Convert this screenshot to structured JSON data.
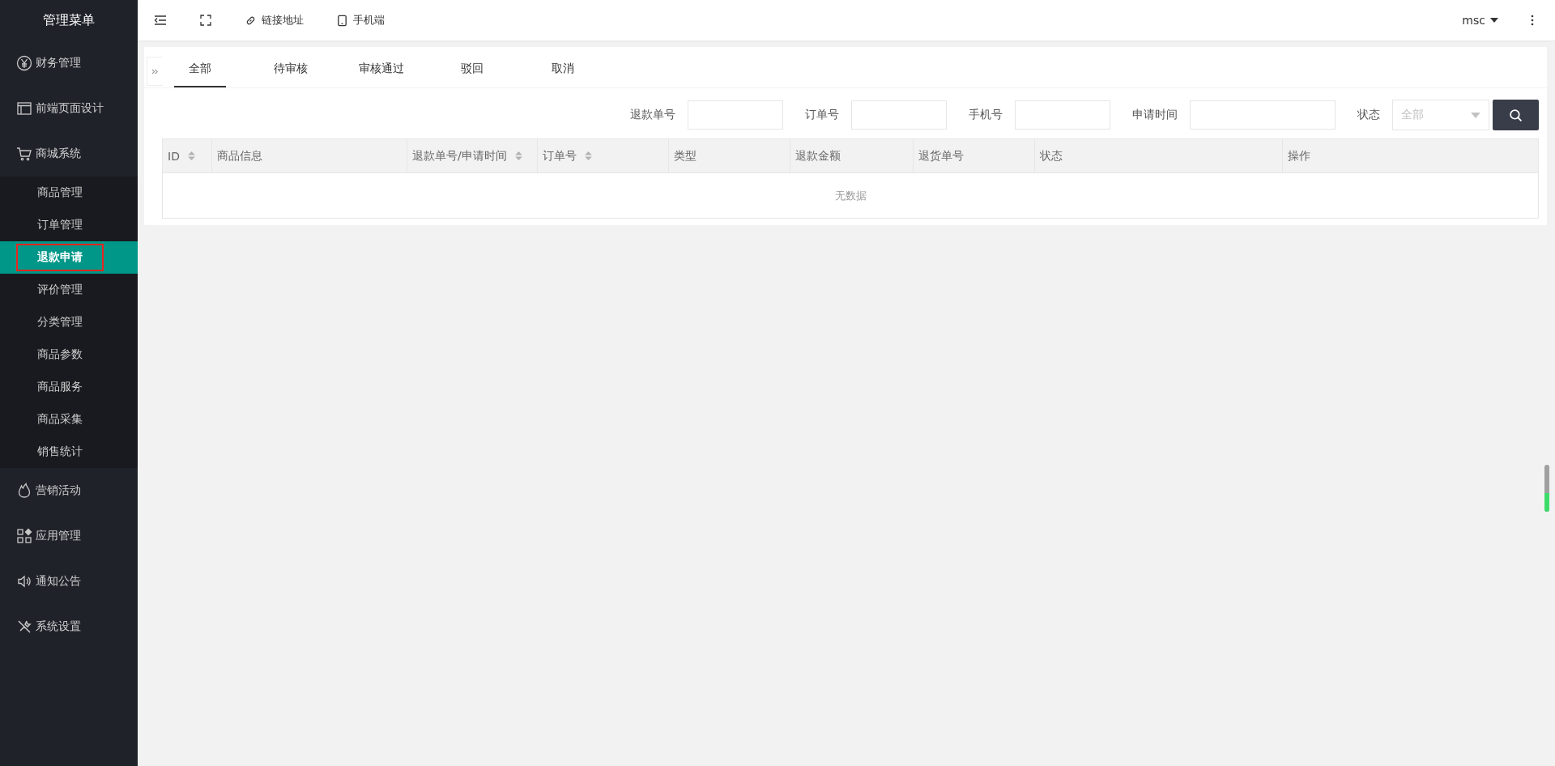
{
  "sidebar": {
    "title": "管理菜单",
    "items": [
      {
        "label": "财务管理",
        "selected": false
      },
      {
        "label": "前端页面设计",
        "selected": false
      },
      {
        "label": "商城系统",
        "selected": false,
        "children": [
          {
            "label": "商品管理",
            "selected": false,
            "highlighted": false
          },
          {
            "label": "订单管理",
            "selected": false,
            "highlighted": false
          },
          {
            "label": "退款申请",
            "selected": true,
            "highlighted": true
          },
          {
            "label": "评价管理",
            "selected": false,
            "highlighted": false
          },
          {
            "label": "分类管理",
            "selected": false,
            "highlighted": false
          },
          {
            "label": "商品参数",
            "selected": false,
            "highlighted": false
          },
          {
            "label": "商品服务",
            "selected": false,
            "highlighted": false
          },
          {
            "label": "商品采集",
            "selected": false,
            "highlighted": false
          },
          {
            "label": "销售统计",
            "selected": false,
            "highlighted": false
          }
        ]
      },
      {
        "label": "营销活动",
        "selected": false
      },
      {
        "label": "应用管理",
        "selected": false
      },
      {
        "label": "通知公告",
        "selected": false
      },
      {
        "label": "系统设置",
        "selected": false
      }
    ]
  },
  "toolbar": {
    "links": [
      "链接地址",
      "手机端"
    ],
    "user": "msc"
  },
  "tabs": [
    {
      "label": "全部",
      "selected": true
    },
    {
      "label": "待审核",
      "selected": false
    },
    {
      "label": "审核通过",
      "selected": false
    },
    {
      "label": "驳回",
      "selected": false
    },
    {
      "label": "取消",
      "selected": false
    }
  ],
  "filters": [
    {
      "label": "退款单号",
      "kind": "input"
    },
    {
      "label": "订单号",
      "kind": "input"
    },
    {
      "label": "手机号",
      "kind": "input"
    },
    {
      "label": "申请时间",
      "kind": "wide"
    },
    {
      "label": "状态",
      "kind": "select",
      "placeholder": "全部"
    }
  ],
  "table": {
    "columns": [
      {
        "label": "ID",
        "sortable": true
      },
      {
        "label": "商品信息",
        "sortable": false
      },
      {
        "label": "退款单号/申请时间",
        "sortable": true
      },
      {
        "label": "订单号",
        "sortable": true
      },
      {
        "label": "类型",
        "sortable": false
      },
      {
        "label": "退款金额",
        "sortable": false
      },
      {
        "label": "退货单号",
        "sortable": false
      },
      {
        "label": "状态",
        "sortable": false
      },
      {
        "label": "操作",
        "sortable": false
      }
    ],
    "empty_text": "无数据"
  }
}
